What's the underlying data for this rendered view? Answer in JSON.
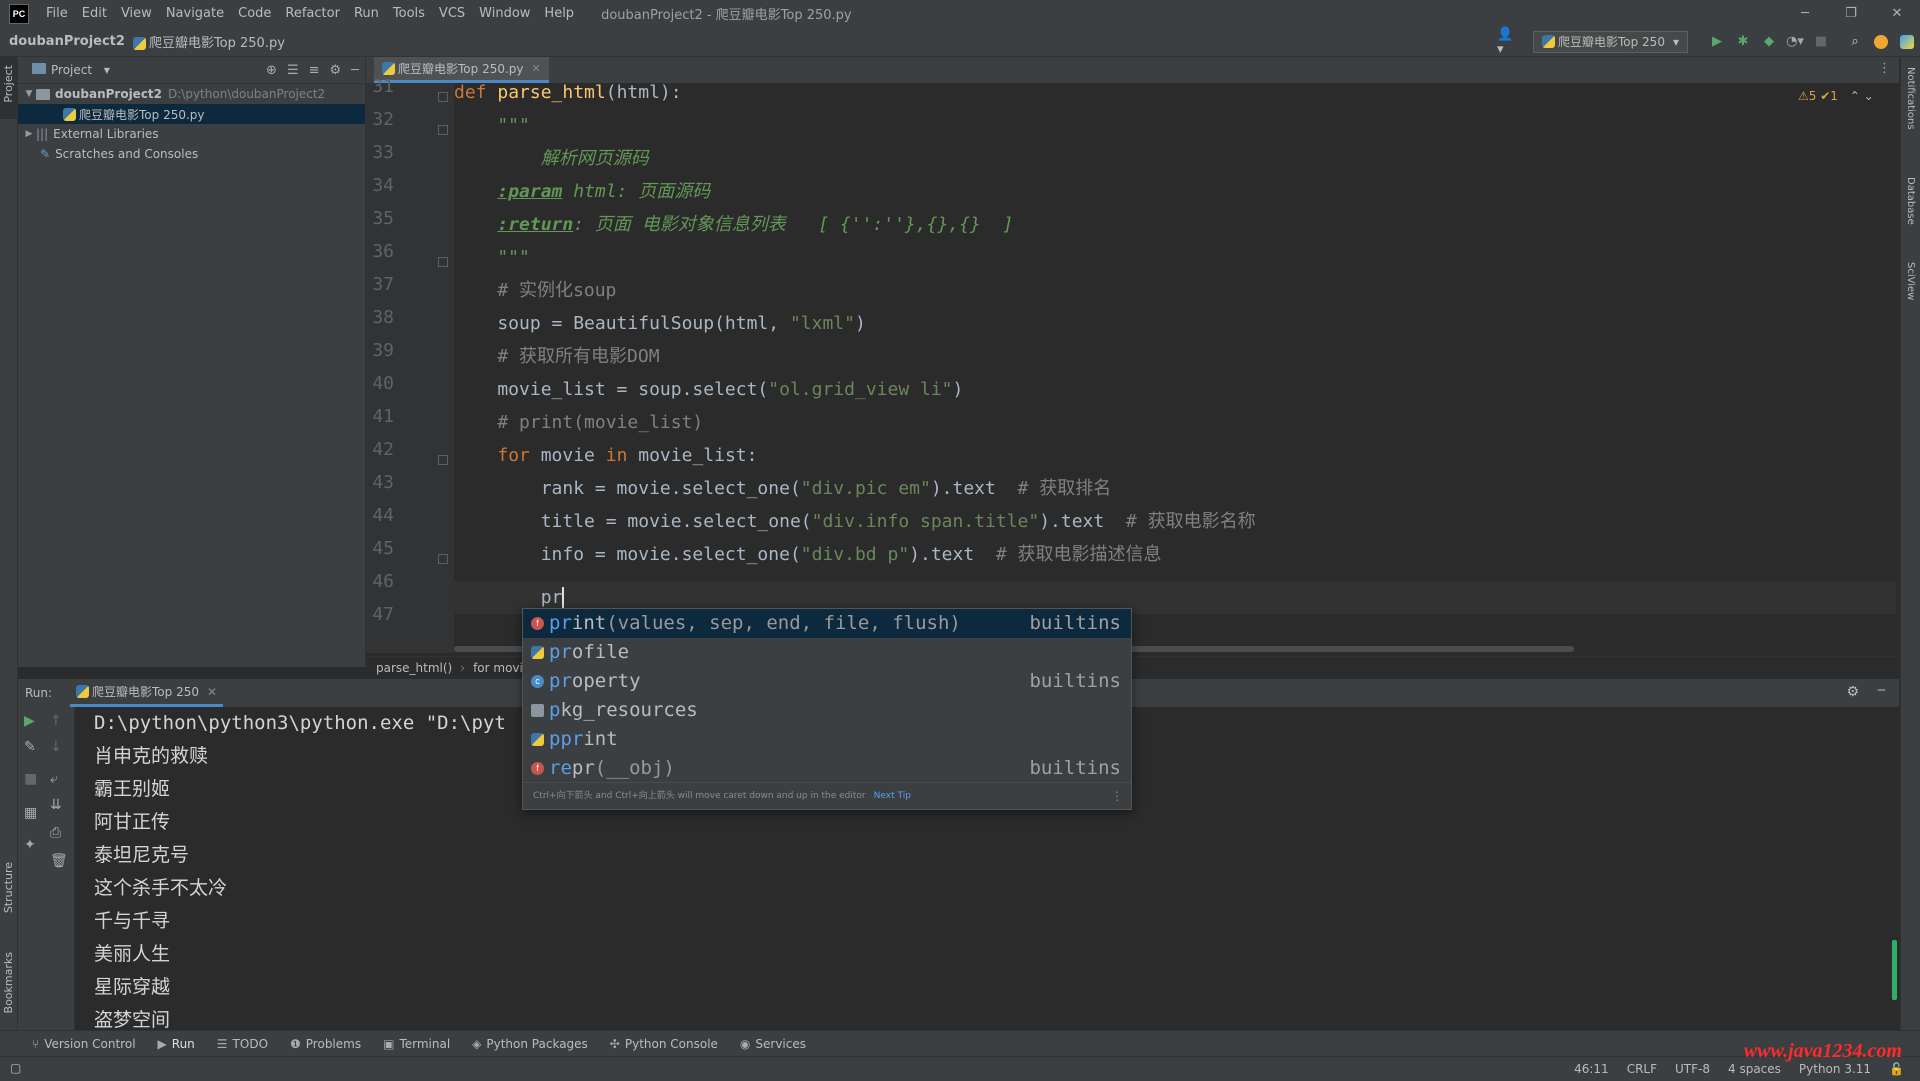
{
  "menubar": {
    "logo": "PC",
    "items": [
      "File",
      "Edit",
      "View",
      "Navigate",
      "Code",
      "Refactor",
      "Run",
      "Tools",
      "VCS",
      "Window",
      "Help"
    ],
    "window_title": "doubanProject2 - 爬豆瓣电影Top 250.py",
    "min": "─",
    "restore": "❐",
    "close": "✕"
  },
  "navbar": {
    "project": "doubanProject2",
    "file": "爬豆瓣电影Top 250.py",
    "run_config": "爬豆瓣电影Top 250",
    "user_icon": "user-icon",
    "run_icon": "run-icon",
    "debug_icon": "debug-icon",
    "search_icon": "search-icon",
    "update_icon": "update-icon"
  },
  "left_stripe": {
    "project": "Project",
    "structure": "Structure",
    "bookmarks": "Bookmarks"
  },
  "right_stripe": {
    "notifications": "Notifications",
    "database": "Database",
    "sciview": "SciView"
  },
  "project_panel": {
    "title": "Project",
    "root_name": "doubanProject2",
    "root_path": "D:\\python\\doubanProject2",
    "file": "爬豆瓣电影Top 250.py",
    "external": "External Libraries",
    "scratches": "Scratches and Consoles"
  },
  "editor": {
    "tab": "爬豆瓣电影Top 250.py",
    "inspections": "⚠5 ✔1",
    "line_numbers": [
      "31",
      "32",
      "33",
      "34",
      "35",
      "36",
      "37",
      "38",
      "39",
      "40",
      "41",
      "42",
      "43",
      "44",
      "45",
      "46",
      "47"
    ],
    "lines": {
      "l31a": "def ",
      "l31b": "parse_html",
      "l31c": "(html):",
      "l32": "    \"\"\"",
      "l33": "        解析网页源码",
      "l34a": "    ",
      "l34b": ":param",
      "l34c": " html: 页面源码",
      "l35a": "    ",
      "l35b": ":return",
      "l35c": ": 页面 电影对象信息列表   [ {'':''},{},{}  ]",
      "l36": "    \"\"\"",
      "l37": "    # 实例化soup",
      "l38a": "    soup = BeautifulSoup(html, ",
      "l38b": "\"lxml\"",
      "l38c": ")",
      "l39": "    # 获取所有电影DOM",
      "l40a": "    movie_list = soup.select(",
      "l40b": "\"ol.grid_view li\"",
      "l40c": ")",
      "l41": "    # print(movie_list)",
      "l42a": "    ",
      "l42b": "for",
      "l42c": " movie ",
      "l42d": "in",
      "l42e": " movie_list:",
      "l43a": "        rank = movie.select_one(",
      "l43b": "\"div.pic em\"",
      "l43c": ").text  ",
      "l43d": "# 获取排名",
      "l44a": "        title = movie.select_one(",
      "l44b": "\"div.info span.title\"",
      "l44c": ").text  ",
      "l44d": "# 获取电影名称",
      "l45a": "        info = movie.select_one(",
      "l45b": "\"div.bd p\"",
      "l45c": ").text  ",
      "l45d": "# 获取电影描述信息",
      "l46": "        pr"
    },
    "breadcrumb": [
      "parse_html()",
      "for movi"
    ]
  },
  "popup": {
    "items": [
      {
        "match": "pr",
        "rest": "int",
        "sig": "(values, sep, end, file, flush)",
        "src": "builtins",
        "icon": "f"
      },
      {
        "match": "pr",
        "rest": "ofile",
        "sig": "",
        "src": "",
        "icon": "py"
      },
      {
        "match": "pr",
        "rest": "operty",
        "sig": "",
        "src": "builtins",
        "icon": "c"
      },
      {
        "match": "p",
        "rest": "kg_resources",
        "sig": "",
        "src": "",
        "icon": "pkg"
      },
      {
        "match": "ppr",
        "rest": "int",
        "sig": "",
        "src": "",
        "icon": "py"
      },
      {
        "match": "re",
        "rest": "pr",
        "sig": "(__obj)",
        "src": "builtins",
        "icon": "f"
      }
    ],
    "tip": "Ctrl+向下箭头 and Ctrl+向上箭头 will move caret down and up in the editor",
    "next_tip": "Next Tip",
    "more": "⋮"
  },
  "run": {
    "label": "Run:",
    "tab": "爬豆瓣电影Top 250",
    "cmd": "D:\\python\\python3\\python.exe \"D:\\pyt",
    "output": [
      "肖申克的救赎",
      "霸王别姬",
      "阿甘正传",
      "泰坦尼克号",
      "这个杀手不太冷",
      "千与千寻",
      "美丽人生",
      "星际穿越",
      "盗梦空间"
    ]
  },
  "toolwindows": [
    "Version Control",
    "Run",
    "TODO",
    "Problems",
    "Terminal",
    "Python Packages",
    "Python Console",
    "Services"
  ],
  "status": {
    "position": "46:11",
    "line_sep": "CRLF",
    "encoding": "UTF-8",
    "indent": "4 spaces",
    "interpreter": "Python 3.11"
  },
  "watermark": "www.java1234.com"
}
